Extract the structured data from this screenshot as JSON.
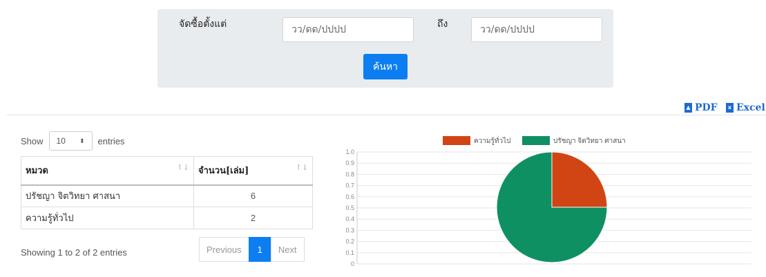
{
  "search": {
    "from_label": "จัดซื้อตั้งแต่",
    "to_label": "ถึง",
    "from_placeholder": "วว/ดด/ปปปป",
    "to_placeholder": "วว/ดด/ปปปป",
    "submit_label": "ค้นหา"
  },
  "export": {
    "pdf_label": "PDF",
    "excel_label": "Excel"
  },
  "table": {
    "show_prefix": "Show",
    "show_value": "10",
    "show_suffix": "entries",
    "columns": [
      "หมวด",
      "จำนวน[เล่ม]"
    ],
    "rows": [
      {
        "category": "ปรัชญา จิตวิทยา ศาสนา",
        "count": "6"
      },
      {
        "category": "ความรู้ทั่วไป",
        "count": "2"
      }
    ],
    "info": "Showing 1 to 2 of 2 entries",
    "pagination": {
      "previous": "Previous",
      "current": "1",
      "next": "Next"
    }
  },
  "chart_data": {
    "type": "pie",
    "labels": [
      "ความรู้ทั่วไป",
      "ปรัชญา จิตวิทยา ศาสนา"
    ],
    "values": [
      2,
      6
    ],
    "colors": [
      "#d14515",
      "#0f9063"
    ],
    "legend": "top",
    "y_ticks": [
      "1.0",
      "0.9",
      "0.8",
      "0.7",
      "0.6",
      "0.5",
      "0.4",
      "0.3",
      "0.2",
      "0.1",
      "0"
    ],
    "grid": true
  }
}
